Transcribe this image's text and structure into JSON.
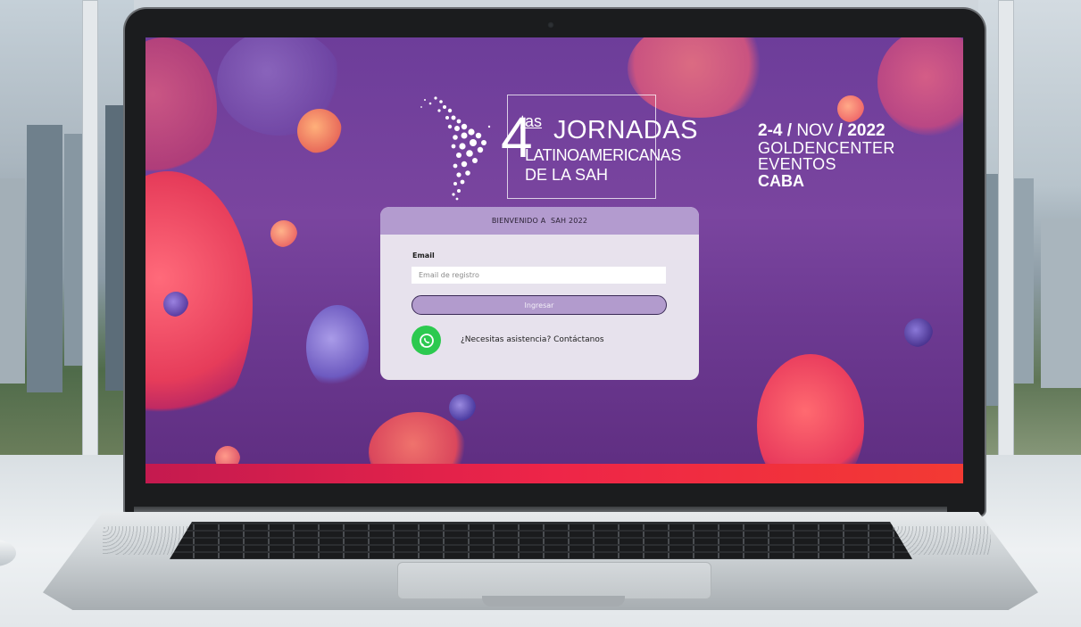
{
  "event": {
    "ordinal_number": "4",
    "ordinal_suffix": "tas",
    "title_line1": "JORNADAS",
    "title_line2": "LATINOAMERICANAS",
    "title_line3": "DE LA SAH",
    "dates_bold": "2-4",
    "slash1": " / ",
    "month": "NOV",
    "slash2": " / ",
    "year": "2022",
    "venue": "GOLDENCENTER EVENTOS",
    "city": "CABA"
  },
  "login": {
    "header": "BIENVENIDO A  SAH 2022",
    "email_label": "Email",
    "email_placeholder": "Email de registro",
    "email_value": "",
    "submit_label": "Ingresar",
    "help_text": "¿Necesitas asistencia? Contáctanos"
  },
  "icons": {
    "whatsapp": "whatsapp-icon",
    "map": "latin-america-map-icon"
  },
  "colors": {
    "background_purple": "#7a459f",
    "card_header": "#b39bcf",
    "button": "#b29bcd",
    "whatsapp_green": "#2cc94f",
    "accent_red": "#ee2548"
  }
}
